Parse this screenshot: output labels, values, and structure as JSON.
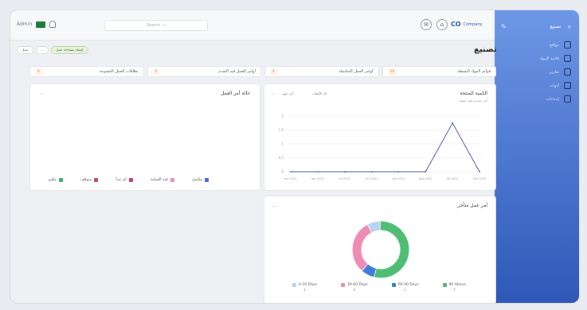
{
  "topbar": {
    "user_name": "Admin",
    "search_placeholder": "Search",
    "brand_logo": "CO",
    "brand_name": "Company"
  },
  "sidebar": {
    "title": "تصنيع",
    "items": [
      {
        "label": "مواقع",
        "icon": "warehouse-icon"
      },
      {
        "label": "قائمة المواد",
        "icon": "list-icon"
      },
      {
        "label": "تقارير",
        "icon": "report-icon"
      },
      {
        "label": "أدوات",
        "icon": "tools-icon"
      },
      {
        "label": "إعدادات",
        "icon": "gear-icon"
      }
    ]
  },
  "breadcrumb": {
    "action_label": "إنشاء مساحة عمل",
    "view_label": "عمل",
    "more_label": "..."
  },
  "page_title": "تصنيع",
  "stats": [
    {
      "label": "قوائم المواد النشطة",
      "value": "18"
    },
    {
      "label": "أوامر العمل المكتملة",
      "value": "4"
    },
    {
      "label": "أوامر العمل قيد التقدم",
      "value": "5"
    },
    {
      "label": "بطاقات العمل المفتوحة",
      "value": "5"
    }
  ],
  "cards": {
    "production": {
      "title": "الكمية المنتجة",
      "subtitle": "آخر تحديث قبل دقيقة",
      "filter1": "كل الأوقات",
      "filter2": "آخر شهر",
      "more": "..."
    },
    "work_order_status": {
      "title": "حالة أمر العمل",
      "more": "..."
    },
    "aging": {
      "title": "أمر عمل متأخر",
      "more": "..."
    }
  },
  "chart_data": [
    {
      "type": "line",
      "x": [
        "Jan 2021",
        "Apr 2021",
        "Jul 2021",
        "Oct 2021",
        "Jan 2022",
        "Apr 2022",
        "Jul 2022",
        "Oct 2022"
      ],
      "series": [
        {
          "values": [
            0,
            0,
            0,
            0,
            0,
            0,
            1.75,
            0
          ]
        }
      ],
      "yticks": [
        "0",
        "0.5",
        "1",
        "1.5",
        "2"
      ],
      "ylim": [
        0,
        2
      ],
      "grid": true,
      "color": "#3b4aa8"
    },
    {
      "type": "bar",
      "legend": [
        "مكتمل",
        "قيد العملية",
        "لم تبدأ",
        "متوقف",
        "ملغي"
      ],
      "colors": [
        "#4a6fd1",
        "#e58fb2",
        "#c2457a",
        "#c84b6b",
        "#45b36b"
      ]
    },
    {
      "type": "pie",
      "categories": [
        "0-30 Days",
        "30-60 Days",
        "60-90 Days",
        "90 Above"
      ],
      "values": [
        1,
        4,
        1,
        7
      ],
      "colors": [
        "#b9d2f1",
        "#ee8db4",
        "#3b7dd8",
        "#4fbd73"
      ]
    }
  ]
}
